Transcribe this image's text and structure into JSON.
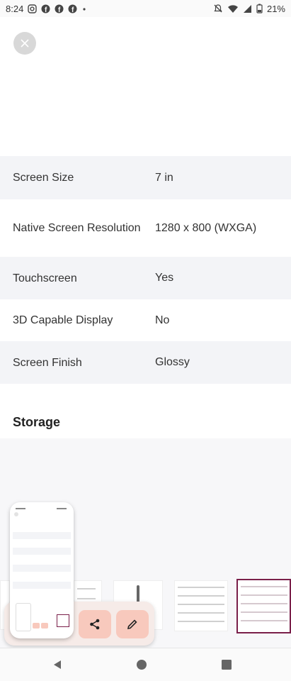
{
  "status_bar": {
    "time": "8:24",
    "notification_icons": [
      "instagram-icon",
      "facebook-icon",
      "facebook-icon",
      "facebook-icon",
      "dot-icon"
    ],
    "system_icons": [
      "mute-icon",
      "wifi-icon",
      "signal-icon",
      "battery-icon"
    ],
    "battery": "21%"
  },
  "specs": [
    {
      "label": "Screen Size",
      "value": "7 in"
    },
    {
      "label": "Native Screen Resolution",
      "value": "1280 x 800 (WXGA)"
    },
    {
      "label": "Touchscreen",
      "value": "Yes"
    },
    {
      "label": "3D Capable Display",
      "value": "No"
    },
    {
      "label": "Screen Finish",
      "value": "Glossy"
    }
  ],
  "storage_section": {
    "title": "Storage"
  },
  "toolbar": {
    "share_icon": "share-icon",
    "edit_icon": "pencil-icon"
  },
  "nav_bar": {
    "icons": [
      "back-icon",
      "home-icon",
      "recents-icon"
    ]
  },
  "colors": {
    "accent": "#7a1f4a",
    "button_bg": "#f8c9bd",
    "row_shade": "#f3f4f7"
  }
}
